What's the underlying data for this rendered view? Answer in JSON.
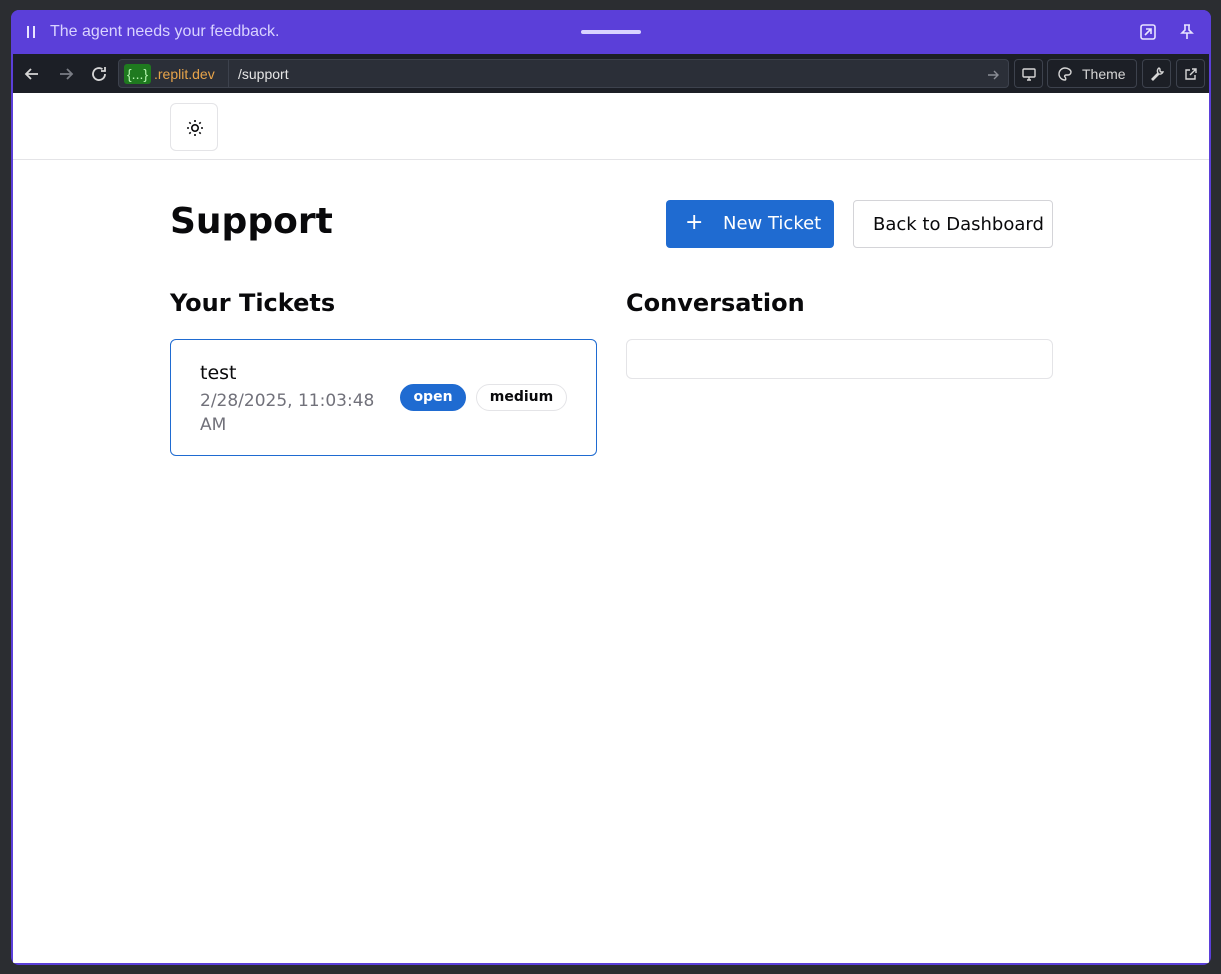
{
  "banner": {
    "message": "The agent needs your feedback."
  },
  "browser": {
    "url_tag": "{...}",
    "url_domain": ".replit.dev",
    "url_path": "/support",
    "theme_label": "Theme"
  },
  "page": {
    "title": "Support",
    "new_ticket_label": "New Ticket",
    "new_ticket_icon": "+",
    "back_label": "Back to Dashboard",
    "tickets_heading": "Your Tickets",
    "conversation_heading": "Conversation"
  },
  "tickets": [
    {
      "title": "test",
      "date": "2/28/2025, 11:03:48 AM",
      "status": "open",
      "priority": "medium"
    }
  ],
  "colors": {
    "banner": "#5b3fd9",
    "primary": "#1f6bd1",
    "toolbar": "#1c1f26"
  }
}
